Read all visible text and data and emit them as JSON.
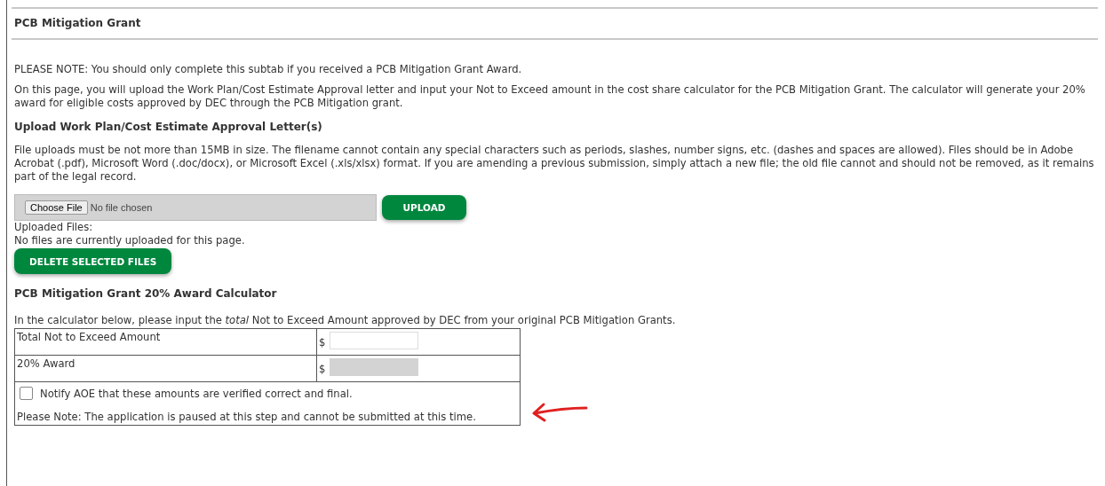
{
  "section_title": "PCB Mitigation Grant",
  "intro": [
    "PLEASE NOTE: You should only complete this subtab if you received a PCB Mitigation Grant Award.",
    "On this page, you will upload the Work Plan/Cost Estimate Approval letter and input your Not to Exceed amount in the cost share calculator for the PCB Mitigation Grant. The calculator will generate your 20% award for eligible costs approved by DEC through the PCB Mitigation grant."
  ],
  "upload": {
    "heading": "Upload Work Plan/Cost Estimate Approval Letter(s)",
    "instructions": "File uploads must be not more than 15MB in size. The filename cannot contain any special characters such as periods, slashes, number signs, etc. (dashes and spaces are allowed). Files should be in Adobe Acrobat (.pdf), Microsoft Word (.doc/docx), or Microsoft Excel (.xls/xlsx) format. If you are amending a previous submission, simply attach a new file; the old file cannot and should not be removed, as it remains part of the legal record.",
    "choose_button": "Choose File",
    "file_status": "No file chosen",
    "upload_button": "UPLOAD",
    "uploaded_label": "Uploaded Files:",
    "uploaded_status": "No files are currently uploaded for this page.",
    "delete_button": "DELETE SELECTED FILES"
  },
  "calculator": {
    "heading": "PCB Mitigation Grant 20% Award Calculator",
    "intro": "In the calculator below, please input the *total* Not to Exceed Amount approved by DEC from your original PCB Mitigation Grants.",
    "rows": [
      {
        "label": "Total Not to Exceed Amount",
        "currency": "$",
        "disabled": false
      },
      {
        "label": "20% Award",
        "currency": "$",
        "disabled": true
      }
    ],
    "notify": {
      "label": "Notify AOE that these amounts are verified correct and final.",
      "checked": false
    },
    "note": "Please Note: The application is paused at this step and cannot be submitted at this time."
  }
}
